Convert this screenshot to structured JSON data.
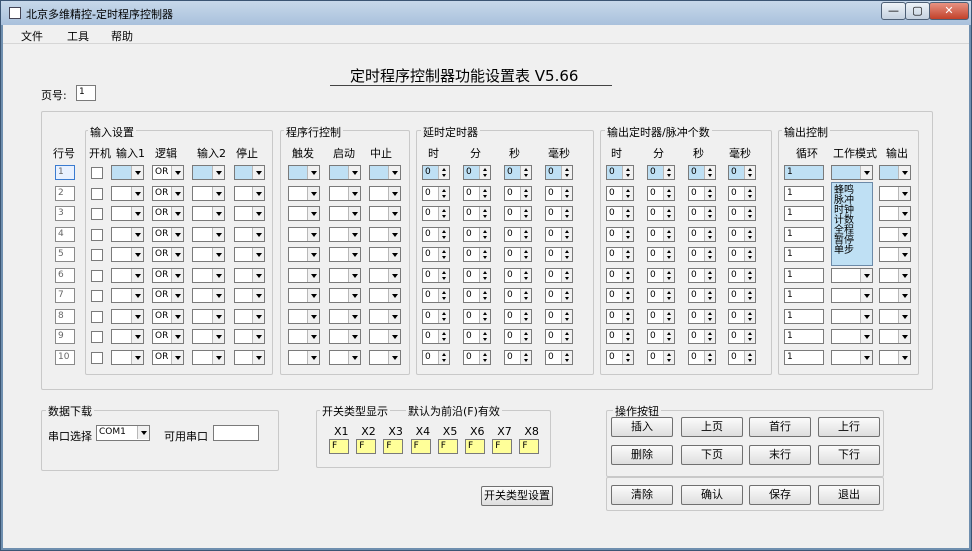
{
  "window": {
    "title": "北京多维精控-定时程序控制器",
    "controls": [
      "—",
      "▢",
      "✕"
    ]
  },
  "menu": [
    "文件",
    "工具",
    "帮助"
  ],
  "form_title": "定时程序控制器功能设置表 V5.66",
  "page": {
    "label": "页号:",
    "value": "1"
  },
  "table": {
    "row_header": "行号",
    "rows": [
      "1",
      "2",
      "3",
      "4",
      "5",
      "6",
      "7",
      "8",
      "9",
      "10"
    ],
    "groups": {
      "input": {
        "title": "输入设置",
        "cols": [
          "开机",
          "输入1",
          "逻辑",
          "输入2",
          "停止"
        ],
        "logic_default": "OR"
      },
      "program": {
        "title": "程序行控制",
        "cols": [
          "触发",
          "启动",
          "中止"
        ]
      },
      "delay": {
        "title": "延时定时器",
        "cols": [
          "时",
          "分",
          "秒",
          "毫秒"
        ],
        "default": "0"
      },
      "output_timer": {
        "title": "输出定时器/脉冲个数",
        "cols": [
          "时",
          "分",
          "秒",
          "毫秒"
        ],
        "default": "0"
      },
      "output_ctrl": {
        "title": "输出控制",
        "cols": [
          "循环",
          "工作模式",
          "输出"
        ],
        "loop_default": "1"
      }
    },
    "mode_dropdown_options": [
      "蜂鸣",
      "脉冲",
      "时钟",
      "计数",
      "全程",
      "暂停",
      "单步"
    ]
  },
  "download": {
    "title": "数据下载",
    "port_label": "串口选择",
    "port_value": "COM1",
    "avail_label": "可用串口",
    "avail_value": ""
  },
  "switch_display": {
    "title": "开关类型显示",
    "note": "默认为前沿(F)有效",
    "labels": [
      "X1",
      "X2",
      "X3",
      "X4",
      "X5",
      "X6",
      "X7",
      "X8"
    ],
    "values": [
      "F",
      "F",
      "F",
      "F",
      "F",
      "F",
      "F",
      "F"
    ]
  },
  "switch_button": "开关类型设置",
  "ops": {
    "title": "操作按钮",
    "row1": [
      "插入",
      "上页",
      "首行",
      "上行"
    ],
    "row2": [
      "删除",
      "下页",
      "末行",
      "下行"
    ]
  },
  "bottom_buttons": [
    "清除",
    "确认",
    "保存",
    "退出"
  ]
}
